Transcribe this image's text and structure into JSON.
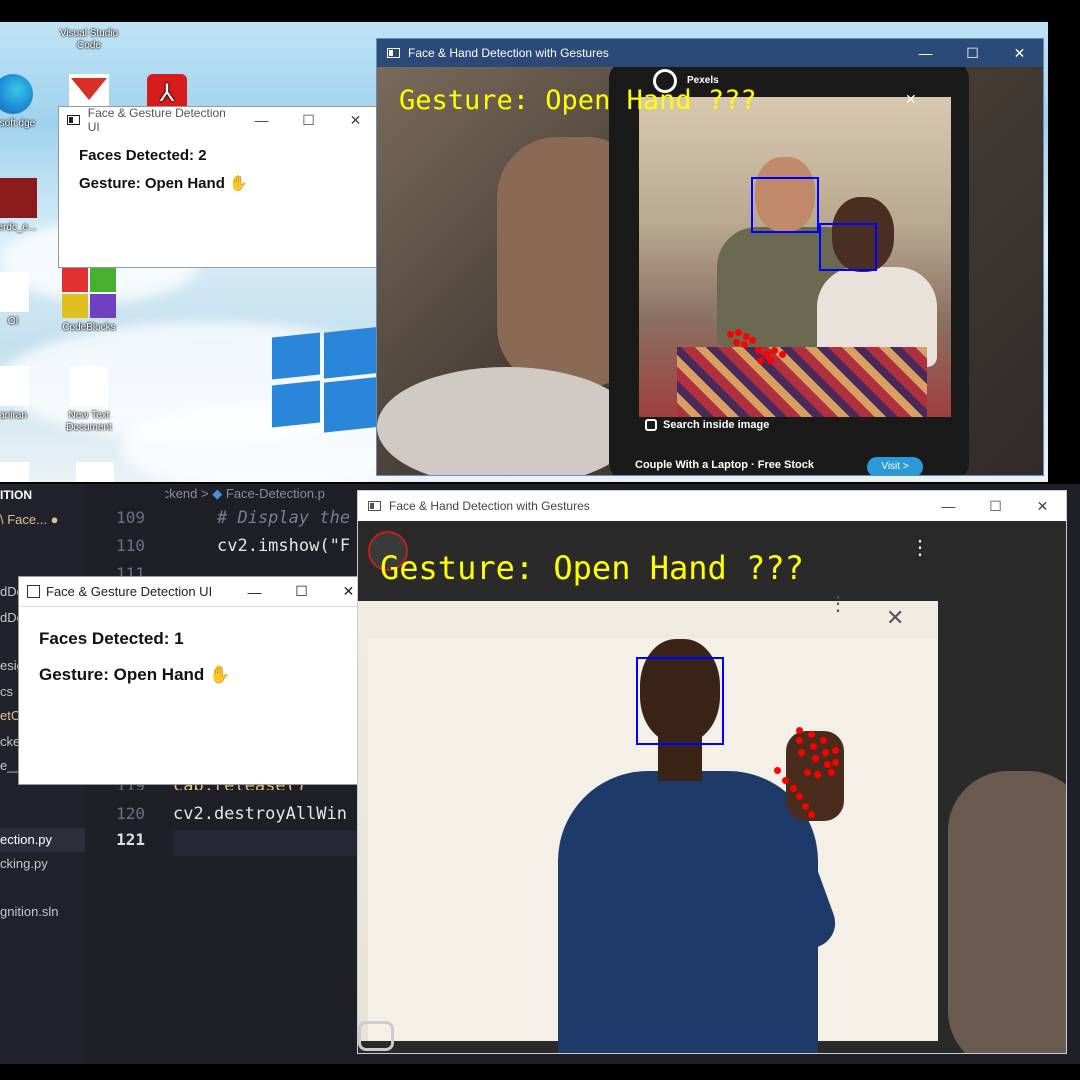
{
  "desktop": {
    "icons": [
      {
        "label": "Visual Studio Code"
      },
      {
        "label": "rosoft dge"
      },
      {
        "label": "S"
      },
      {
        "label": "erdc_e..."
      },
      {
        "label": "OI"
      },
      {
        "label": "CodeBlocks"
      },
      {
        "label": "aniran"
      },
      {
        "label": "New Text Document"
      }
    ]
  },
  "top_cam_window": {
    "title": "Face & Hand Detection with Gestures",
    "overlay_text": "Gesture: Open Hand ???",
    "phone_ui": {
      "brand": "Pexels",
      "search_label": "Search inside image",
      "caption": "Couple With a Laptop · Free Stock",
      "visit_button": "Visit >"
    },
    "faces": 2
  },
  "top_gui_window": {
    "title": "Face & Gesture Detection UI",
    "faces_line": "Faces Detected: 2",
    "gesture_line": "Gesture: Open Hand ✋"
  },
  "editor": {
    "breadcrumb": {
      "folder": "Python-Backend",
      "separator": ">",
      "file": "Face-Detection.p"
    },
    "explorer": {
      "header": "ITION",
      "items": [
        {
          "label": "Face...",
          "highlight": true
        },
        {
          "label": "dDe"
        },
        {
          "label": "dDe"
        },
        {
          "label": "esig"
        },
        {
          "label": "cs"
        },
        {
          "label": "etC"
        },
        {
          "label": "cke"
        },
        {
          "label": "e__"
        },
        {
          "label": "ection.py"
        },
        {
          "label": "cking.py"
        },
        {
          "label": "gnition.sln"
        }
      ]
    },
    "lines": [
      {
        "num": "109",
        "text": "# Display the",
        "kind": "comment"
      },
      {
        "num": "110",
        "text": "cv2.imshow(\"F",
        "kind": "code"
      },
      {
        "num": "111",
        "text": "",
        "kind": "code"
      },
      {
        "num": "119",
        "text": "cap.release()",
        "kind": "code"
      },
      {
        "num": "120",
        "text": "cv2.destroyAllWin",
        "kind": "code"
      },
      {
        "num": "121",
        "text": "",
        "kind": "code"
      }
    ]
  },
  "bottom_cam_window": {
    "title": "Face & Hand Detection with Gestures",
    "overlay_text": "Gesture: Open Hand ???",
    "faces": 1
  },
  "bottom_gui_window": {
    "title": "Face & Gesture Detection UI",
    "faces_line": "Faces Detected: 1",
    "gesture_line": "Gesture: Open Hand ✋"
  },
  "window_controls": {
    "minimize": "—",
    "maximize": "☐",
    "close": "✕"
  },
  "colors": {
    "overlay_text": "#ffff00",
    "face_box": "#0000ff",
    "hand_landmark": "#ff0000"
  }
}
